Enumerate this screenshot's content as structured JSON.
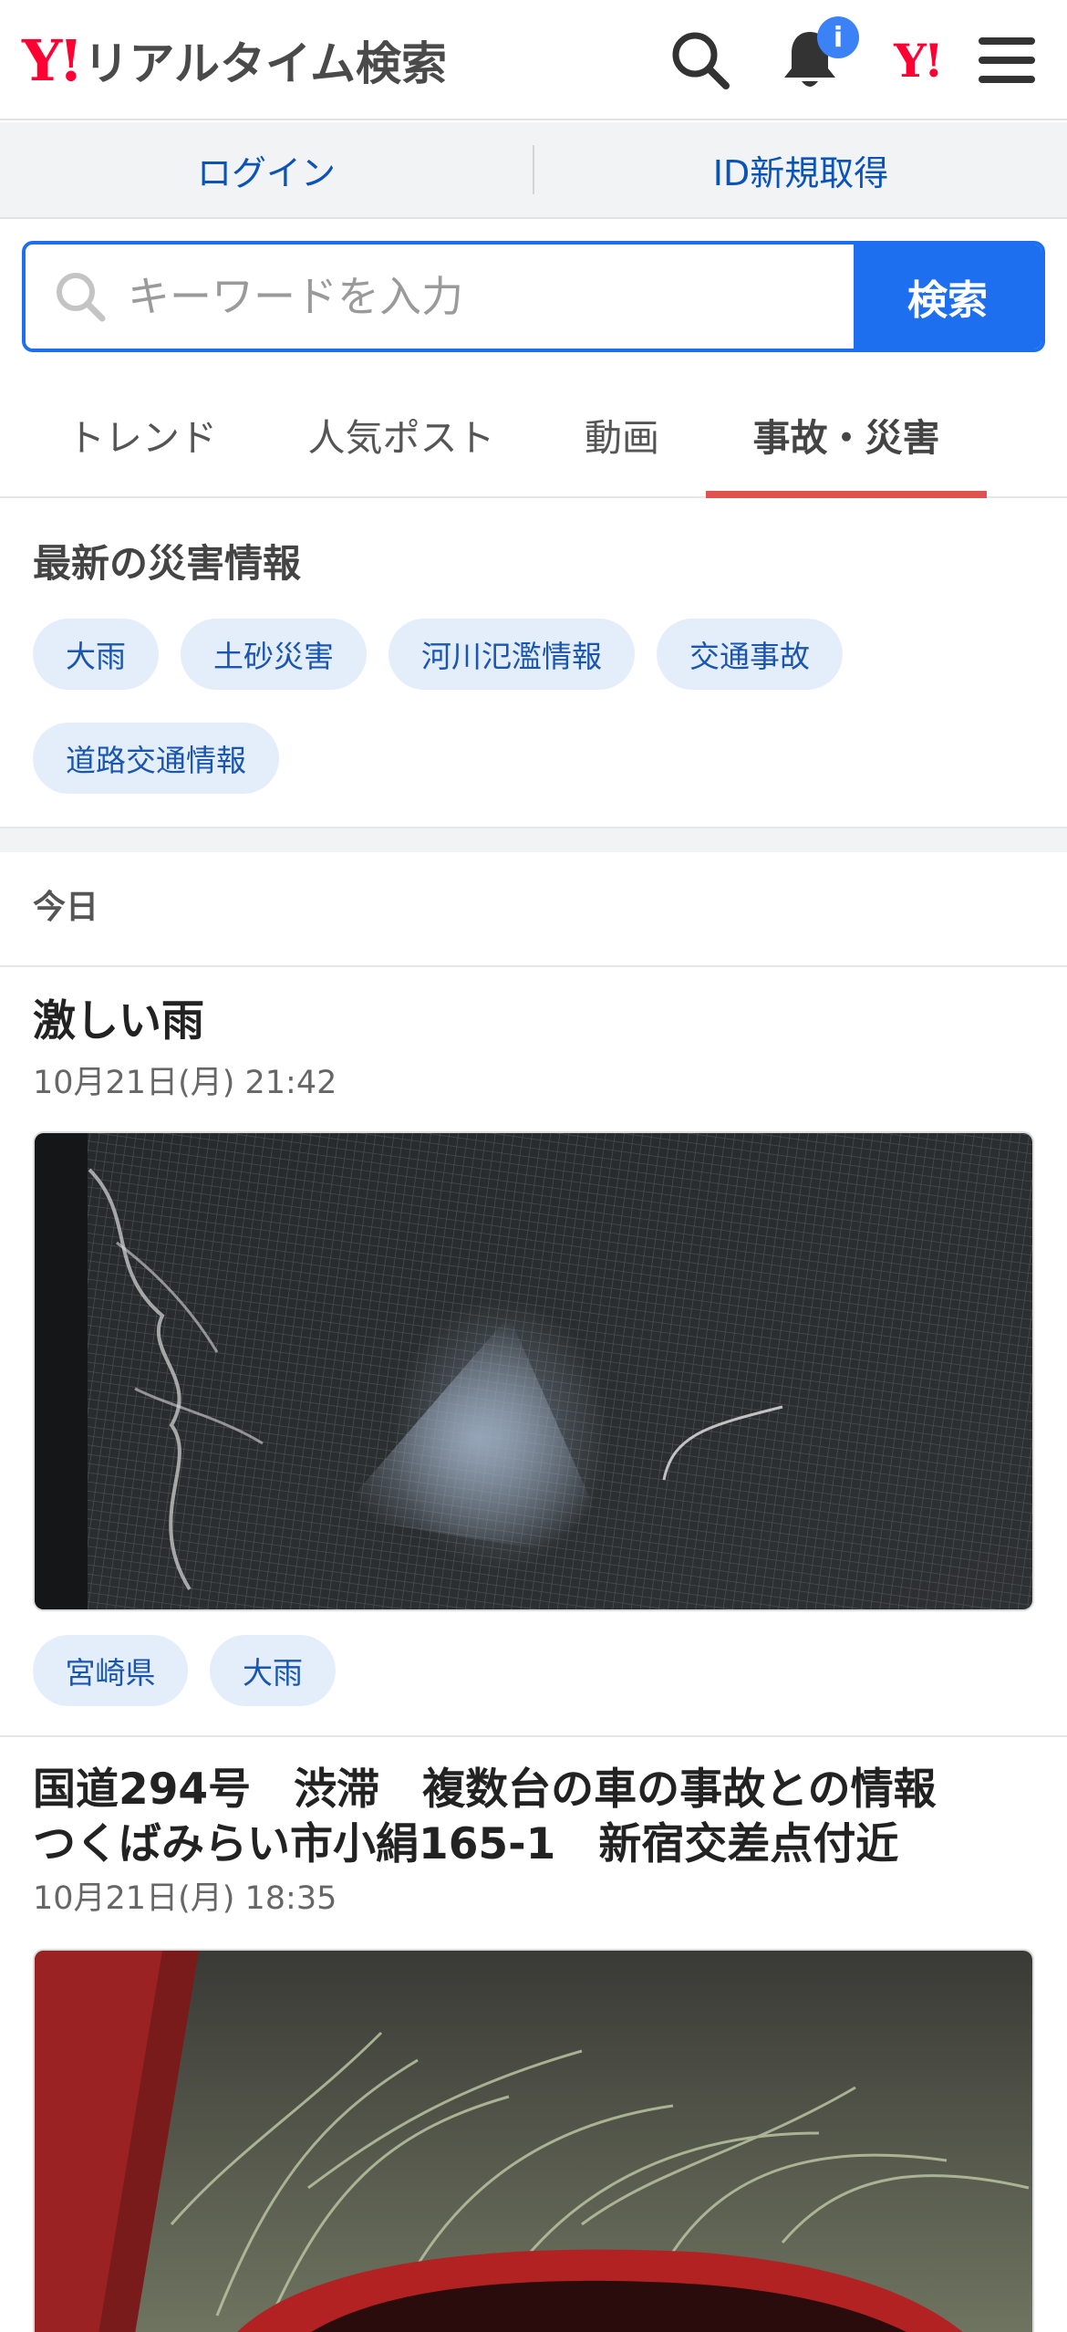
{
  "header": {
    "logo_mark": "Y!",
    "logo_text": "リアルタイム検索",
    "notification_badge": "i",
    "yahoo_mark": "Y!",
    "icons": [
      "search-icon",
      "bell-icon",
      "yahoo-logo",
      "menu-icon"
    ]
  },
  "auth": {
    "login": "ログイン",
    "register": "ID新規取得"
  },
  "search": {
    "placeholder": "キーワードを入力",
    "button": "検索"
  },
  "tabs": [
    {
      "label": "トレンド",
      "active": false
    },
    {
      "label": "人気ポスト",
      "active": false
    },
    {
      "label": "動画",
      "active": false
    },
    {
      "label": "事故・災害",
      "active": true
    }
  ],
  "disaster": {
    "title": "最新の災害情報",
    "chips": [
      "大雨",
      "土砂災害",
      "河川氾濫情報",
      "交通事故",
      "道路交通情報"
    ]
  },
  "day_label": "今日",
  "posts": [
    {
      "title": "激しい雨",
      "time": "10月21日(月) 21:42",
      "tags": [
        "宮崎県",
        "大雨"
      ]
    },
    {
      "title_lines": [
        "国道294号　渋滞　複数台の車の事故との情報",
        "つくばみらい市小絹165-1　新宿交差点付近"
      ],
      "time": "10月21日(月) 18:35"
    }
  ],
  "colors": {
    "accent": "#1e6ff0",
    "brand": "#ff0033",
    "tab_underline": "#e0524e",
    "chip_bg": "#e4eefb",
    "chip_text": "#1a56b0",
    "badge": "#3b82f6"
  }
}
